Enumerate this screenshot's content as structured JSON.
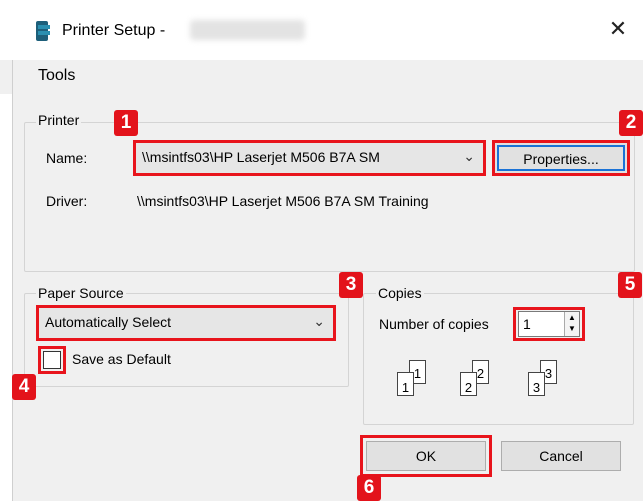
{
  "window": {
    "title": "Printer Setup -",
    "close_glyph": "✕",
    "icon": "printer-app-icon"
  },
  "menu": {
    "tools": "Tools"
  },
  "printer_group": {
    "legend": "Printer",
    "name_label": "Name:",
    "name_value": "\\\\msintfs03\\HP Laserjet M506 B7A SM",
    "properties_label": "Properties...",
    "driver_label": "Driver:",
    "driver_value": "\\\\msintfs03\\HP Laserjet M506 B7A SM Training"
  },
  "paper_group": {
    "legend": "Paper Source",
    "source_value": "Automatically Select",
    "save_default_label": "Save as Default",
    "save_default_checked": false
  },
  "copies_group": {
    "legend": "Copies",
    "number_label": "Number of copies",
    "number_value": "1",
    "collate_pages": [
      "1",
      "1",
      "2",
      "2",
      "3",
      "3"
    ]
  },
  "buttons": {
    "ok": "OK",
    "cancel": "Cancel"
  },
  "badges": [
    "1",
    "2",
    "3",
    "4",
    "5",
    "6"
  ],
  "colors": {
    "highlight_red": "#e8141c",
    "focus_blue": "#1a72d6",
    "dialog_bg": "#f0f0f0"
  }
}
